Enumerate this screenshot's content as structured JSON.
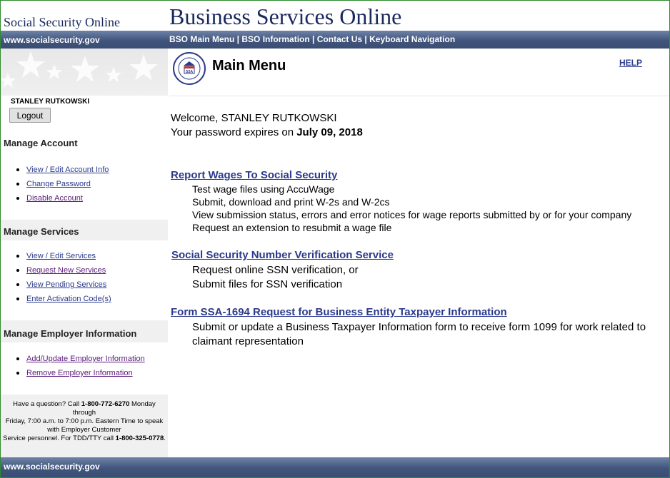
{
  "header": {
    "site_name": "Social Security Online",
    "title": "Business Services Online"
  },
  "navbar": {
    "url": "www.socialsecurity.gov",
    "links": [
      "BSO Main Menu",
      "BSO Information",
      "Contact Us",
      "Keyboard Navigation"
    ],
    "separator": " | "
  },
  "sidebar": {
    "username": "STANLEY RUTKOWSKI",
    "logout_label": "Logout",
    "sections": [
      {
        "title": "Manage Account",
        "items": [
          "View / Edit Account Info",
          "Change Password",
          "Disable Account"
        ]
      },
      {
        "title": "Manage Services",
        "items": [
          "View / Edit Services",
          "Request New Services",
          "View Pending Services",
          "Enter Activation Code(s)"
        ]
      },
      {
        "title": "Manage Employer Information",
        "items": [
          "Add/Update Employer Information",
          "Remove Employer Information"
        ]
      }
    ],
    "help": {
      "line_a": "Have a question? Call ",
      "phone": "1-800-772-6270",
      "line_b": " Monday through",
      "line_c": "Friday, 7:00 a.m. to 7:00 p.m. Eastern Time to speak with Employer Customer",
      "line_d": "Service personnel. For TDD/TTY call ",
      "tty": "1-800-325-0778",
      "line_e": "."
    }
  },
  "main": {
    "title": "Main Menu",
    "help_link": "HELP",
    "seal_text": "SOCIAL SECURITY ADMINISTRATION",
    "seal_abbr": "SSA",
    "welcome": "Welcome, STANLEY RUTKOWSKI",
    "password_prefix": "Your password expires on ",
    "password_date": "July 09, 2018",
    "services": [
      {
        "title": "Report Wages To Social Security",
        "lines": [
          "Test wage files using AccuWage",
          "Submit, download and print W-2s and W-2cs",
          "View submission status, errors and error notices for wage reports submitted by or for your company",
          "Request an extension to resubmit a wage file"
        ]
      },
      {
        "title": "Social Security Number Verification Service",
        "lines": [
          "Request online SSN verification, or",
          "Submit files for SSN verification"
        ]
      },
      {
        "title": "Form SSA-1694 Request for Business Entity Taxpayer Information",
        "lines": [
          "Submit or update a Business Taxpayer Information form to receive form 1099 for work related to",
          "claimant representation"
        ]
      }
    ]
  },
  "footer": {
    "url": "www.socialsecurity.gov"
  },
  "colors": {
    "nav_blue": "#41557d",
    "link_blue": "#2b3a8c",
    "visited_purple": "#5a1a7a",
    "title_navy": "#1a2a5e"
  }
}
